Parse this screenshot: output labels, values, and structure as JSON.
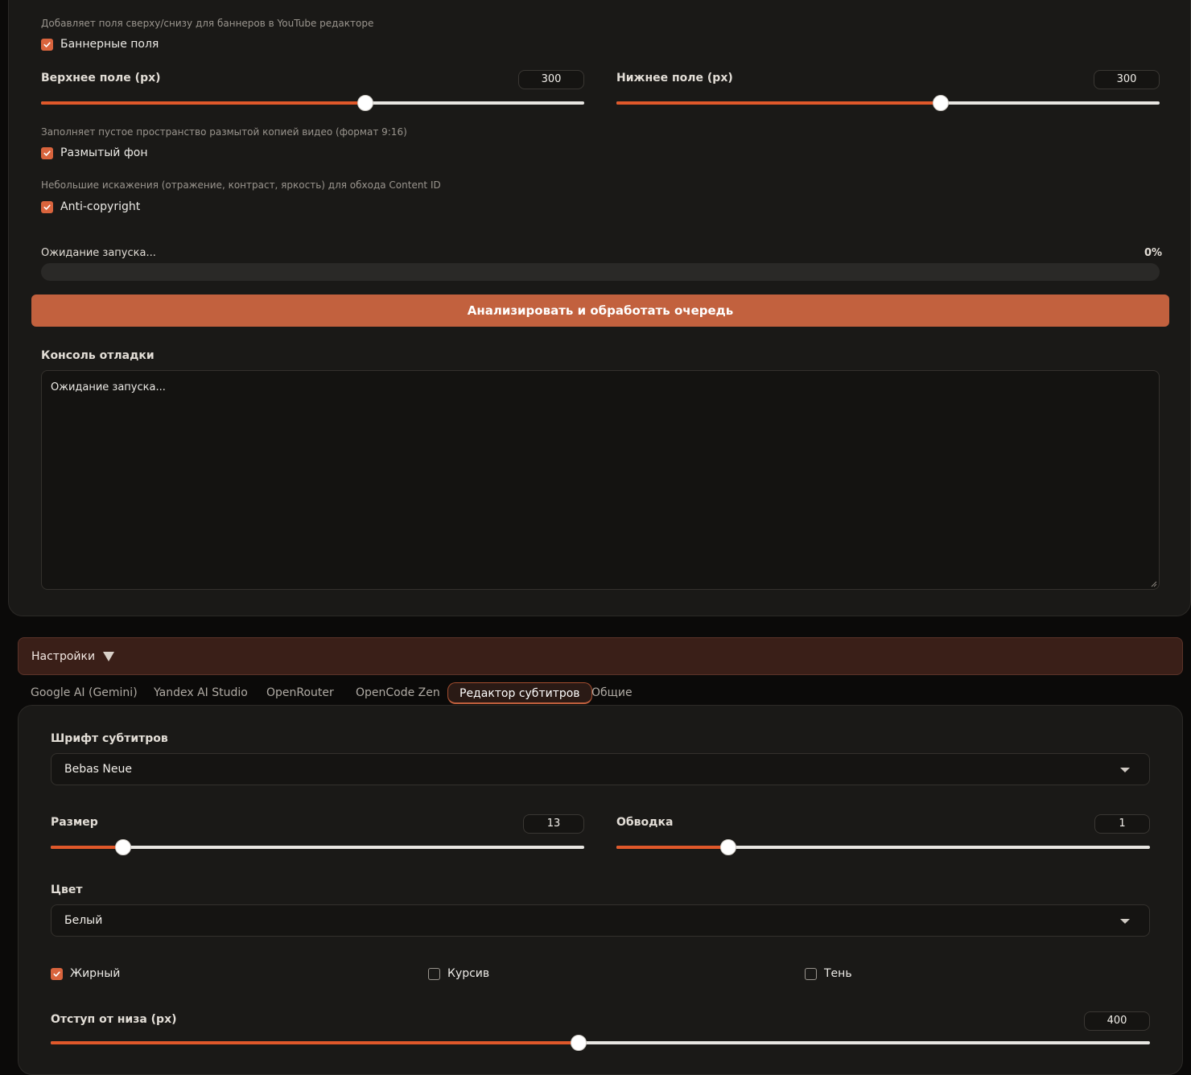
{
  "banner": {
    "hint": "Добавляет поля сверху/снизу для баннеров в YouTube редакторе",
    "checkbox_label": "Баннерные поля",
    "checked": true,
    "top_label": "Верхнее поле (px)",
    "top_value": "300",
    "top_fraction": 0.597,
    "bottom_label": "Нижнее поле (px)",
    "bottom_value": "300",
    "bottom_fraction": 0.597
  },
  "blur": {
    "hint": "Заполняет пустое пространство размытой копией видео (формат 9:16)",
    "checkbox_label": "Размытый фон",
    "checked": true
  },
  "anticopy": {
    "hint": "Небольшие искажения (отражение, контраст, яркость) для обхода Content ID",
    "checkbox_label": "Anti-copyright",
    "checked": true
  },
  "progress": {
    "status": "Ожидание запуска...",
    "percent_label": "0%",
    "fraction": 0
  },
  "run_button": "Анализировать и обработать очередь",
  "console": {
    "label": "Консоль отладки",
    "text": "Ожидание запуска..."
  },
  "settings": {
    "title": "Настройки",
    "tabs": [
      "Google AI (Gemini)",
      "Yandex AI Studio",
      "OpenRouter",
      "OpenCode Zen",
      "Редактор субтитров",
      "Общие"
    ],
    "active_tab": "Редактор субтитров"
  },
  "subtitles": {
    "font_label": "Шрифт субтитров",
    "font_value": "Bebas Neue",
    "size_label": "Размер",
    "size_value": "13",
    "size_fraction": 0.135,
    "stroke_label": "Обводка",
    "stroke_value": "1",
    "stroke_fraction": 0.21,
    "color_label": "Цвет",
    "color_value": "Белый",
    "bold_label": "Жирный",
    "bold_checked": true,
    "italic_label": "Курсив",
    "italic_checked": false,
    "shadow_label": "Тень",
    "shadow_checked": false,
    "offset_label": "Отступ от низа (px)",
    "offset_value": "400",
    "offset_fraction": 0.48
  },
  "colors": {
    "accent": "#d9643d",
    "slider_fill": "#e0582a",
    "button": "#c2613e",
    "panel": "#1a1917",
    "accordion": "#3a1f18"
  },
  "icons": {
    "checkbox": "check-icon",
    "accordion": "triangle-down-icon",
    "select": "caret-down-icon",
    "resize": "resize-handle-icon"
  }
}
